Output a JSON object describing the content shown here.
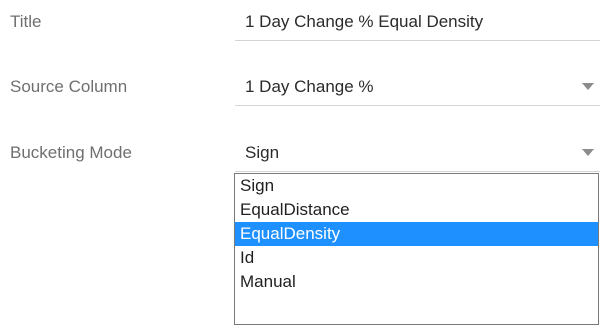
{
  "form": {
    "title": {
      "label": "Title",
      "value": "1 Day Change % Equal Density"
    },
    "source_column": {
      "label": "Source Column",
      "value": "1 Day Change %"
    },
    "bucketing_mode": {
      "label": "Bucketing Mode",
      "value": "Sign",
      "options": [
        "Sign",
        "EqualDistance",
        "EqualDensity",
        "Id",
        "Manual"
      ],
      "highlighted_option": "EqualDensity"
    }
  },
  "icons": {
    "dropdown": "chevron-down-icon"
  },
  "colors": {
    "label_text": "#6f6f6f",
    "value_text": "#2b2b2b",
    "underline": "#d4d4d4",
    "highlight": "#1e90ff"
  }
}
